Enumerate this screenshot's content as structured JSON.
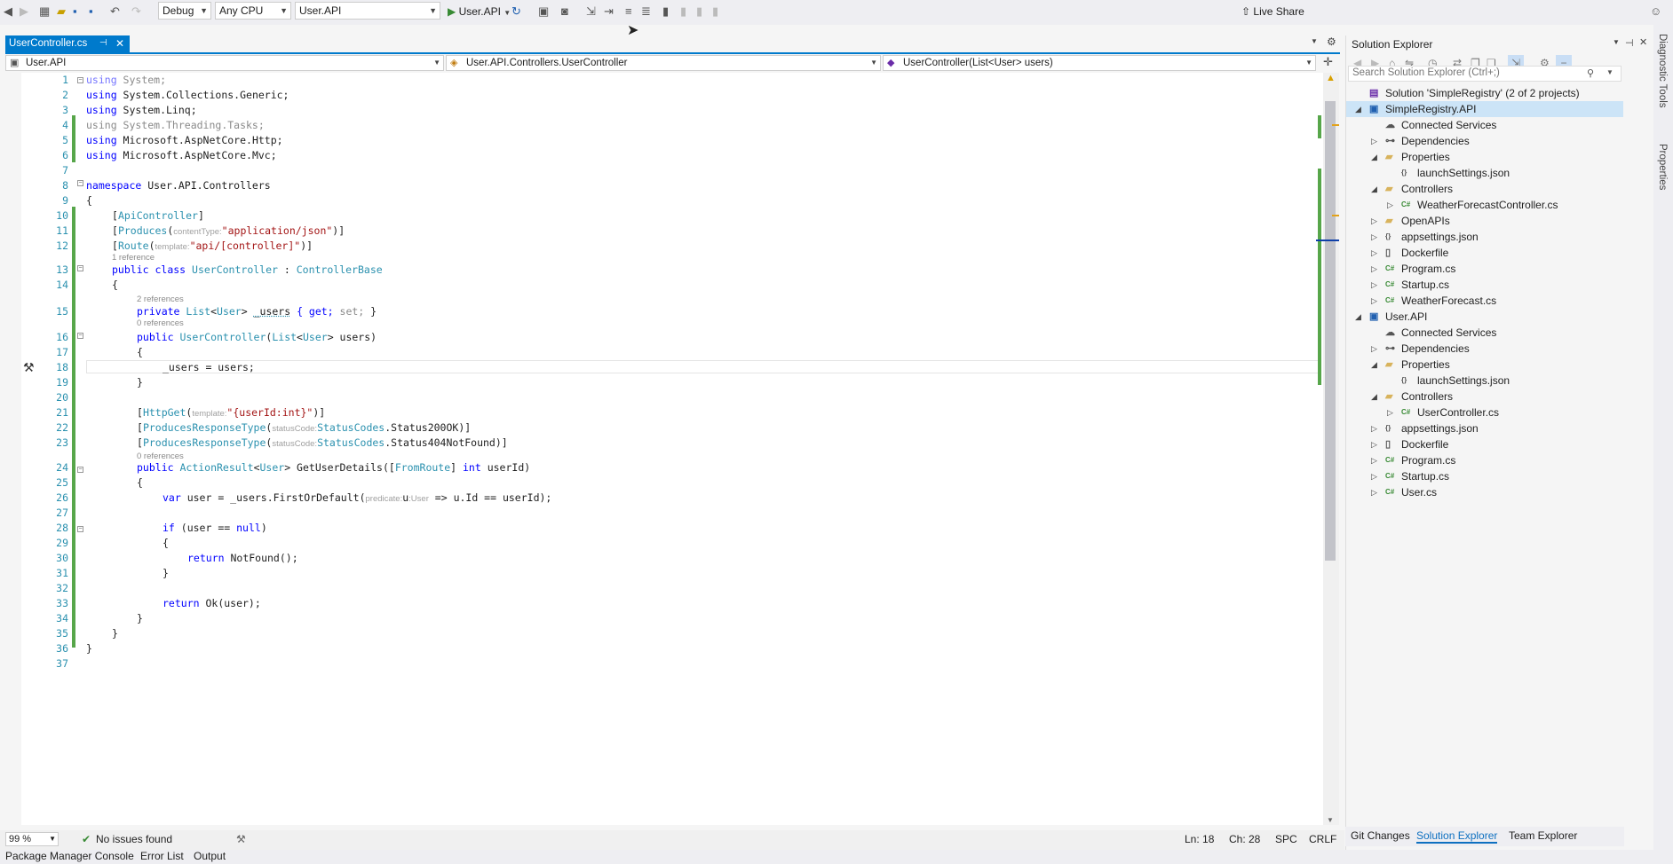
{
  "toolbar": {
    "configuration": "Debug",
    "platform": "Any CPU",
    "startup_project": "User.API",
    "run_label": "User.API",
    "live_share": "Live Share"
  },
  "doc_tab": {
    "name": "UserController.cs"
  },
  "nav": {
    "project": "User.API",
    "type": "User.API.Controllers.UserController",
    "member": "UserController(List<User> users)"
  },
  "code_lines": [
    "using System;",
    "using System.Collections.Generic;",
    "using System.Linq;",
    "using System.Threading.Tasks;",
    "using Microsoft.AspNetCore.Http;",
    "using Microsoft.AspNetCore.Mvc;",
    "",
    "namespace User.API.Controllers",
    "{",
    "[ApiController]",
    "[Produces(contentType: \"application/json\")]",
    "[Route(template: \"api/[controller]\")]",
    "public class UserController : ControllerBase",
    "{",
    "private List<User> _users { get; set; }",
    "public UserController(List<User> users)",
    "{",
    "_users = users;",
    "}",
    "",
    "[HttpGet(template: \"{userId:int}\")]",
    "[ProducesResponseType(statusCode: StatusCodes.Status200OK)]",
    "[ProducesResponseType(statusCode: StatusCodes.Status404NotFound)]",
    "public ActionResult<User> GetUserDetails([FromRoute] int userId)",
    "{",
    "var user = _users.FirstOrDefault(predicate: u :User => u.Id == userId);",
    "",
    "if (user == null)",
    "{",
    "return NotFound();",
    "}",
    "",
    "return Ok(user);",
    "}",
    "}",
    "}",
    ""
  ],
  "code_tokens": {
    "l1_using": "using",
    "l1_rest": " System;",
    "l2_using": "using",
    "l2_rest": " System.Collections.Generic;",
    "l3_using": "using",
    "l3_rest": " System.Linq;",
    "l4": "using System.Threading.Tasks;",
    "l5_using": "using",
    "l5_rest": " Microsoft.AspNetCore.Http;",
    "l6_using": "using",
    "l6_rest": " Microsoft.AspNetCore.Mvc;",
    "l8_ns": "namespace",
    "l8_rest": " User.API.Controllers",
    "brace_open": "{",
    "brace_close": "}",
    "l10_a": "[",
    "l10_b": "ApiController",
    "l10_c": "]",
    "l11_a": "[",
    "l11_b": "Produces",
    "l11_c": "(",
    "l11_hint": "contentType:",
    "l11_str": "\"application/json\"",
    "l11_d": ")]",
    "l12_a": "[",
    "l12_b": "Route",
    "l12_c": "(",
    "l12_hint": "template:",
    "l12_str": "\"api/[controller]\"",
    "l12_d": ")]",
    "l13_public": "public",
    "l13_class": " class ",
    "l13_name": "UserController",
    "l13_colon": " : ",
    "l13_base": "ControllerBase",
    "l15_private": "private ",
    "l15_list": "List",
    "l15_lt": "<",
    "l15_user": "User",
    "l15_gt": "> ",
    "l15_name": "_users",
    "l15_get": " { get; ",
    "l15_set": "set;",
    "l15_end": " }",
    "l16_public": "public ",
    "l16_name": "UserController",
    "l16_p1": "(",
    "l16_list": "List",
    "l16_p2": "<",
    "l16_user": "User",
    "l16_p3": "> users)",
    "l18": "_users = users;",
    "l21_a": "[",
    "l21_b": "HttpGet",
    "l21_c": "(",
    "l21_hint": "template:",
    "l21_str": "\"{userId:int}\"",
    "l21_d": ")]",
    "l22_a": "[",
    "l22_b": "ProducesResponseType",
    "l22_c": "(",
    "l22_hint": "statusCode:",
    "l22_sc": "StatusCodes",
    "l22_d": ".Status200OK)]",
    "l23_a": "[",
    "l23_b": "ProducesResponseType",
    "l23_c": "(",
    "l23_hint": "statusCode:",
    "l23_sc": "StatusCodes",
    "l23_d": ".Status404NotFound)]",
    "l24_public": "public ",
    "l24_ar": "ActionResult",
    "l24_lt": "<",
    "l24_user": "User",
    "l24_gt": "> GetUserDetails([",
    "l24_fr": "FromRoute",
    "l24_b": "] ",
    "l24_int": "int",
    "l24_end": " userId)",
    "l26_var": "var",
    "l26_a": " user = _users.FirstOrDefault(",
    "l26_hint": "predicate:",
    "l26_u": "u",
    "l26_hint2": ":User",
    "l26_b": " => u.Id == userId);",
    "l28_if": "if",
    "l28_rest": " (user == ",
    "l28_null": "null",
    "l28_end": ")",
    "l30_ret": "return",
    "l30_rest": " NotFound();",
    "l33_ret": "return",
    "l33_rest": " Ok(user);"
  },
  "references": {
    "r1": "1 reference",
    "r2": "2 references",
    "r3": "0 references",
    "r4": "0 references"
  },
  "status": {
    "zoom": "99 %",
    "issues": "No issues found",
    "line": "Ln: 18",
    "col": "Ch: 28",
    "mode": "SPC",
    "eol": "CRLF"
  },
  "bottom_tabs": [
    "Package Manager Console",
    "Error List",
    "Output"
  ],
  "solution_explorer": {
    "title": "Solution Explorer",
    "search_placeholder": "Search Solution Explorer (Ctrl+;)",
    "items": [
      {
        "label": "Solution 'SimpleRegistry' (2 of 2 projects)",
        "level": 0,
        "expander": "",
        "icon": "solution-icon"
      },
      {
        "label": "SimpleRegistry.API",
        "level": 0,
        "expander": "◢",
        "icon": "project-icon"
      },
      {
        "label": "Connected Services",
        "level": 1,
        "expander": "",
        "icon": "connected-services-icon"
      },
      {
        "label": "Dependencies",
        "level": 1,
        "expander": "▷",
        "icon": "dependencies-icon"
      },
      {
        "label": "Properties",
        "level": 1,
        "expander": "◢",
        "icon": "folder-icon"
      },
      {
        "label": "launchSettings.json",
        "level": 2,
        "expander": "",
        "icon": "json-file-icon"
      },
      {
        "label": "Controllers",
        "level": 1,
        "expander": "◢",
        "icon": "folder-icon"
      },
      {
        "label": "WeatherForecastController.cs",
        "level": 2,
        "expander": "▷",
        "icon": "csharp-file-icon"
      },
      {
        "label": "OpenAPIs",
        "level": 1,
        "expander": "▷",
        "icon": "folder-icon"
      },
      {
        "label": "appsettings.json",
        "level": 1,
        "expander": "▷",
        "icon": "json-file-icon"
      },
      {
        "label": "Dockerfile",
        "level": 1,
        "expander": "▷",
        "icon": "file-icon"
      },
      {
        "label": "Program.cs",
        "level": 1,
        "expander": "▷",
        "icon": "csharp-file-icon"
      },
      {
        "label": "Startup.cs",
        "level": 1,
        "expander": "▷",
        "icon": "csharp-file-icon"
      },
      {
        "label": "WeatherForecast.cs",
        "level": 1,
        "expander": "▷",
        "icon": "csharp-file-icon"
      },
      {
        "label": "User.API",
        "level": 0,
        "expander": "◢",
        "icon": "project-icon"
      },
      {
        "label": "Connected Services",
        "level": 1,
        "expander": "",
        "icon": "connected-services-icon"
      },
      {
        "label": "Dependencies",
        "level": 1,
        "expander": "▷",
        "icon": "dependencies-icon"
      },
      {
        "label": "Properties",
        "level": 1,
        "expander": "◢",
        "icon": "folder-icon"
      },
      {
        "label": "launchSettings.json",
        "level": 2,
        "expander": "",
        "icon": "json-file-icon"
      },
      {
        "label": "Controllers",
        "level": 1,
        "expander": "◢",
        "icon": "folder-icon"
      },
      {
        "label": "UserController.cs",
        "level": 2,
        "expander": "▷",
        "icon": "csharp-file-icon"
      },
      {
        "label": "appsettings.json",
        "level": 1,
        "expander": "▷",
        "icon": "json-file-icon"
      },
      {
        "label": "Dockerfile",
        "level": 1,
        "expander": "▷",
        "icon": "file-icon"
      },
      {
        "label": "Program.cs",
        "level": 1,
        "expander": "▷",
        "icon": "csharp-file-icon"
      },
      {
        "label": "Startup.cs",
        "level": 1,
        "expander": "▷",
        "icon": "csharp-file-icon"
      },
      {
        "label": "User.cs",
        "level": 1,
        "expander": "▷",
        "icon": "csharp-file-icon"
      }
    ],
    "selected_item": "SimpleRegistry.API",
    "tabs": [
      "Git Changes",
      "Solution Explorer",
      "Team Explorer"
    ],
    "active_tab": "Solution Explorer"
  },
  "side_panels": [
    "Diagnostic Tools",
    "Properties"
  ],
  "colors": {
    "accent": "#007acc",
    "change_bar": "#57a64a",
    "keyword": "#0000ff",
    "type": "#2b91af",
    "string": "#a31515"
  }
}
